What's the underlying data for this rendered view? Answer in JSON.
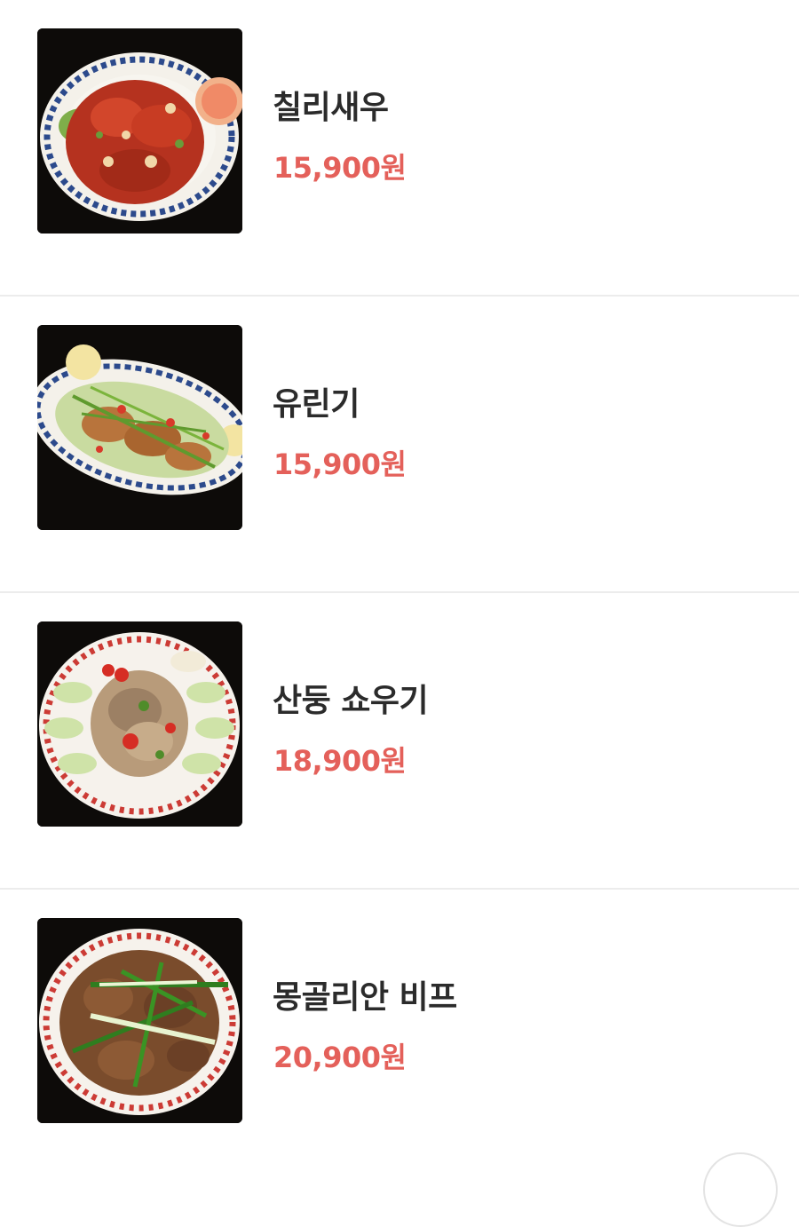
{
  "menu": {
    "items": [
      {
        "name": "칠리새우",
        "price": "15,900원",
        "image_icon": "chili-shrimp-dish"
      },
      {
        "name": "유린기",
        "price": "15,900원",
        "image_icon": "yuringi-dish"
      },
      {
        "name": "산둥 쇼우기",
        "price": "18,900원",
        "image_icon": "shandong-chicken-dish"
      },
      {
        "name": "몽골리안 비프",
        "price": "20,900원",
        "image_icon": "mongolian-beef-dish"
      }
    ]
  },
  "colors": {
    "price": "#e4605a",
    "name": "#2b2b2b",
    "divider": "#ececec",
    "photo_background": "#0d0b09"
  }
}
